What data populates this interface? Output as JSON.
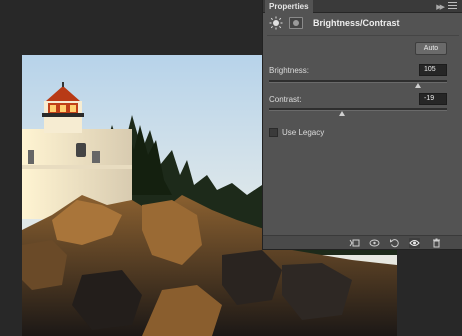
{
  "panel": {
    "tab_label": "Properties",
    "adjustment_title": "Brightness/Contrast",
    "auto_label": "Auto",
    "brightness": {
      "label": "Brightness:",
      "value": "105",
      "level": 0.835
    },
    "contrast": {
      "label": "Contrast:",
      "value": "-19",
      "level": 0.41
    },
    "use_legacy": {
      "label": "Use Legacy",
      "checked": false
    }
  },
  "icons": {
    "collapse": "double-chevron-right-icon",
    "menu": "panel-menu-icon",
    "adjustment": "brightness-contrast-icon",
    "mask": "layer-mask-icon",
    "footer": [
      "clip-to-layer-icon",
      "view-previous-state-icon",
      "reset-icon",
      "visibility-eye-icon",
      "trash-icon"
    ]
  },
  "colors": {
    "panel_bg": "#535353",
    "canvas_bg": "#282828"
  }
}
